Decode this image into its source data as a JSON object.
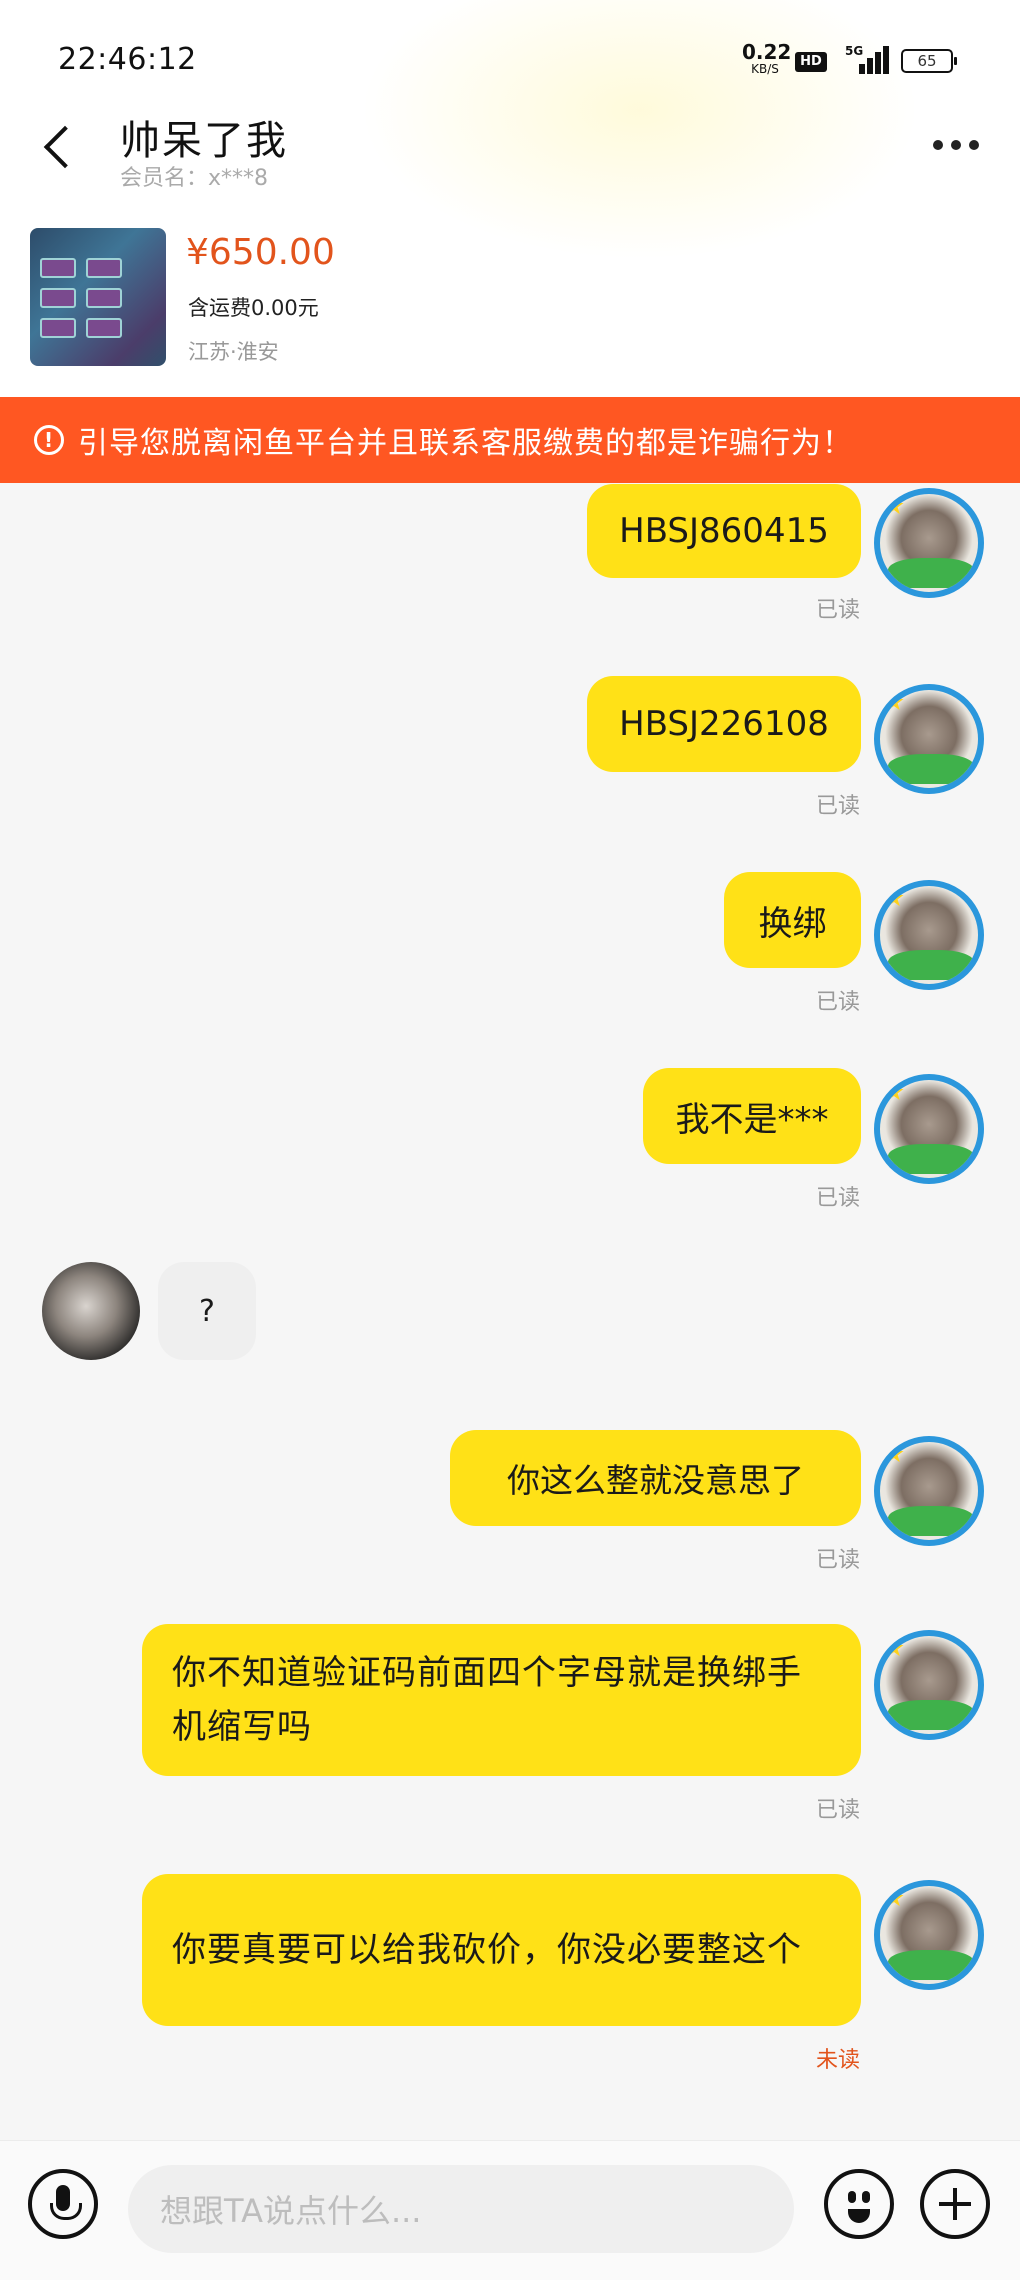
{
  "status_bar": {
    "time": "22:46:12",
    "net_speed": "0.22",
    "net_unit": "KB/S",
    "hd": "HD",
    "network": "5G",
    "battery": "65"
  },
  "header": {
    "title": "帅呆了我",
    "member": "会员名：x***8"
  },
  "product": {
    "price": "¥650.00",
    "shipping": "含运费0.00元",
    "location": "江苏·淮安"
  },
  "warning": {
    "text": "引导您脱离闲鱼平台并且联系客服缴费的都是诈骗行为！"
  },
  "messages": [
    {
      "text": "HBSJ860415",
      "status": "已读"
    },
    {
      "text": "HBSJ226108",
      "status": "已读"
    },
    {
      "text": "换绑",
      "status": "已读"
    },
    {
      "text": "我不是***",
      "status": "已读"
    },
    {
      "text": "?"
    },
    {
      "text": "你这么整就没意思了",
      "status": "已读"
    },
    {
      "text": "你不知道验证码前面四个字母就是换绑手机缩写吗",
      "status": "已读"
    },
    {
      "text": "你要真要可以给我砍价，你没必要整这个",
      "status": "未读"
    }
  ],
  "input": {
    "placeholder": "想跟TA说点什么..."
  },
  "colors": {
    "bubble_self": "#ffe117",
    "warning_bg": "#ff5722",
    "price": "#e2541c",
    "unread": "#e2541c"
  }
}
